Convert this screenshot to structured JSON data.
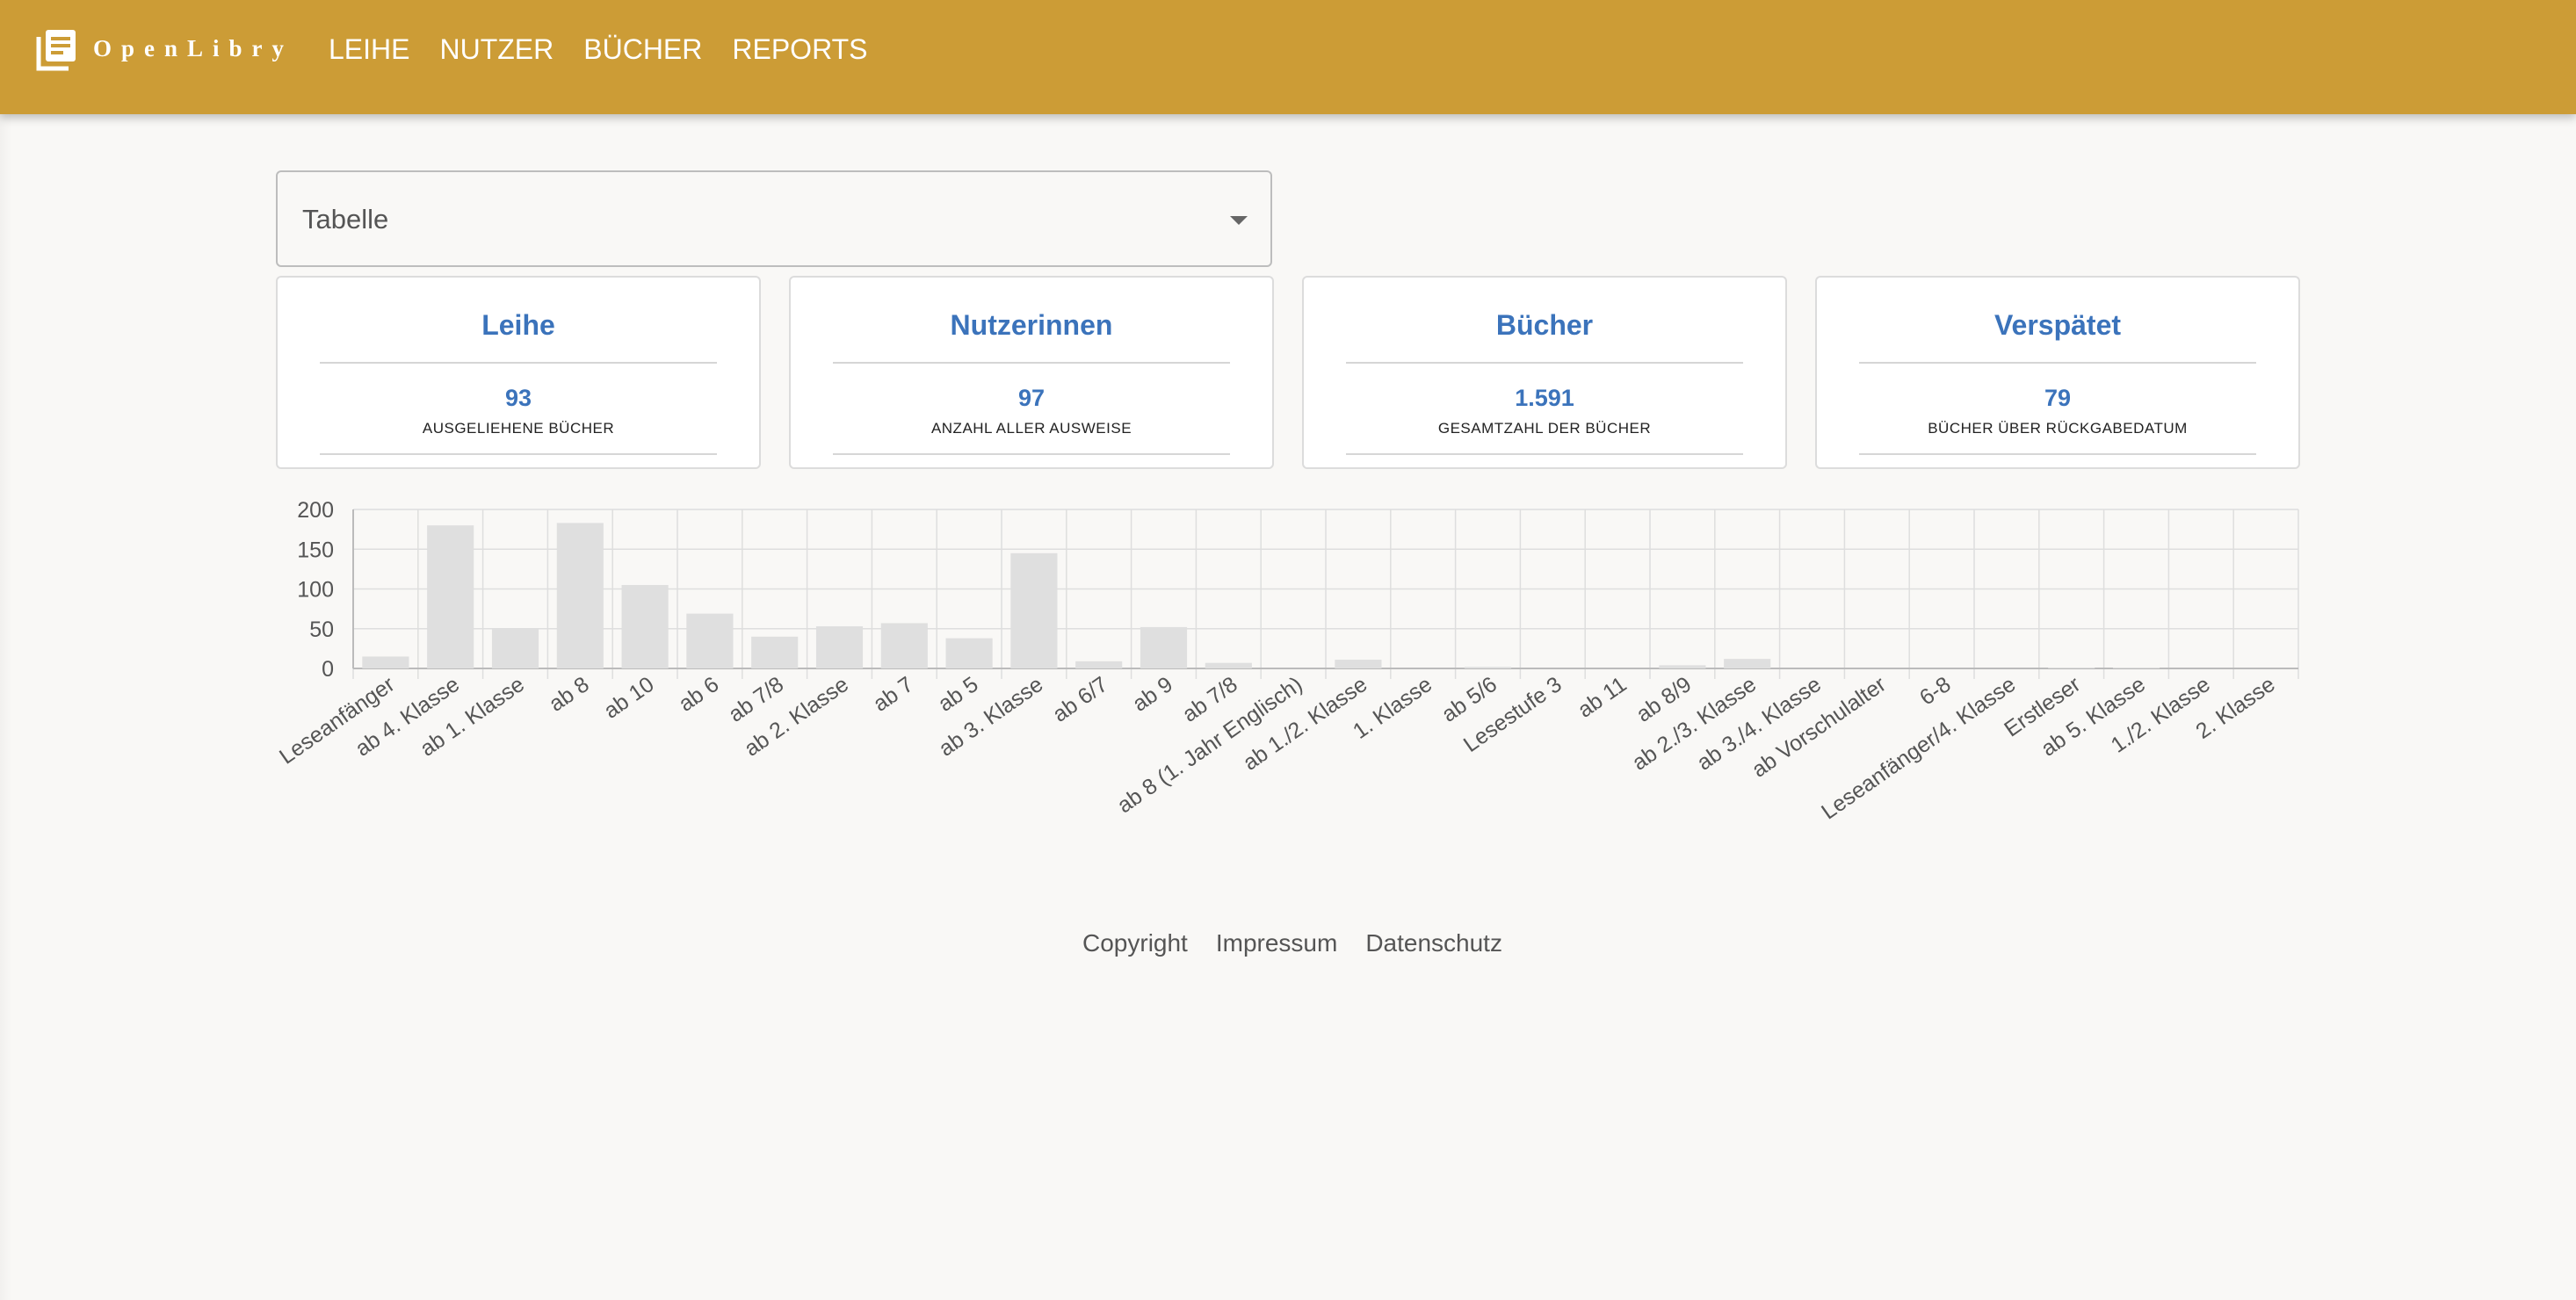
{
  "appbar": {
    "brand": "OpenLibry",
    "nav": [
      "LEIHE",
      "NUTZER",
      "BÜCHER",
      "REPORTS"
    ],
    "color": "#cc9c36"
  },
  "report_select": {
    "value": "Tabelle"
  },
  "cards": [
    {
      "title": "Leihe",
      "value": "93",
      "subtitle": "AUSGELIEHENE BÜCHER"
    },
    {
      "title": "Nutzerinnen",
      "value": "97",
      "subtitle": "ANZAHL ALLER AUSWEISE"
    },
    {
      "title": "Bücher",
      "value": "1.591",
      "subtitle": "GESAMTZAHL DER BÜCHER"
    },
    {
      "title": "Verspätet",
      "value": "79",
      "subtitle": "BÜCHER ÜBER RÜCKGABEDATUM"
    }
  ],
  "accent_color": "#3b73bb",
  "chart_data": {
    "type": "bar",
    "categories": [
      "Leseanfänger",
      "ab 4. Klasse",
      "ab 1. Klasse",
      "ab 8",
      "ab 10",
      "ab 6",
      "ab 7/8",
      "ab 2. Klasse",
      "ab 7",
      "ab 5",
      "ab 3. Klasse",
      "ab 6/7",
      "ab 9",
      "ab  7/8",
      "ab 8 (1. Jahr Englisch)",
      "ab 1./2. Klasse",
      "1. Klasse",
      "ab 5/6",
      "Lesestufe 3",
      "ab 11",
      "ab 8/9",
      "ab 2./3. Klasse",
      "ab 3./4. Klasse",
      "ab Vorschulalter",
      "6-8",
      "Leseanfänger/4. Klasse",
      "Erstleser",
      "ab 5. Klasse",
      "1./2. Klasse",
      "2. Klasse"
    ],
    "values": [
      15,
      180,
      50,
      183,
      105,
      69,
      40,
      53,
      57,
      38,
      145,
      9,
      52,
      7,
      0,
      11,
      0,
      2,
      0,
      0,
      4,
      12,
      0,
      0,
      0,
      0,
      1,
      1,
      0,
      0
    ],
    "yticks": [
      0,
      50,
      100,
      150,
      200
    ],
    "ylim": [
      0,
      200
    ],
    "grid": true,
    "bar_color": "#dfdfdf"
  },
  "footer": {
    "links": [
      "Copyright",
      "Impressum",
      "Datenschutz"
    ]
  }
}
